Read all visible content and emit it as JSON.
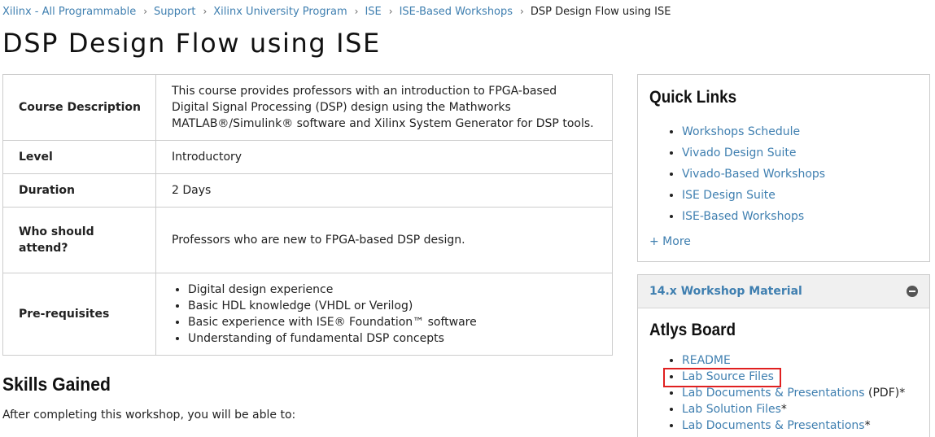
{
  "breadcrumb": {
    "items": [
      "Xilinx - All Programmable",
      "Support",
      "Xilinx University Program",
      "ISE",
      "ISE-Based Workshops"
    ],
    "current": "DSP Design Flow using ISE",
    "separator": "›"
  },
  "page_title": "DSP Design Flow using ISE",
  "course_table": {
    "description_label": "Course Description",
    "description_value": "This course provides professors with an introduction to FPGA-based Digital Signal Processing (DSP) design using the Mathworks MATLAB®/Simulink® software and Xilinx System Generator for DSP tools.",
    "level_label": "Level",
    "level_value": "Introductory",
    "duration_label": "Duration",
    "duration_value": "2 Days",
    "attend_label": "Who should attend?",
    "attend_value": "Professors who are new to FPGA-based DSP design.",
    "prereq_label": "Pre-requisites",
    "prereq_items": [
      "Digital design experience",
      "Basic HDL knowledge (VHDL or Verilog)",
      "Basic experience with ISE® Foundation™ software",
      "Understanding of fundamental DSP concepts"
    ]
  },
  "skills": {
    "heading": "Skills Gained",
    "intro": "After completing this workshop, you will be able to:"
  },
  "quick_links": {
    "title": "Quick Links",
    "items": [
      "Workshops Schedule",
      "Vivado Design Suite",
      "Vivado-Based Workshops",
      "ISE Design Suite",
      "ISE-Based Workshops"
    ],
    "more_label": "+ More"
  },
  "workshop_material": {
    "header": "14.x Workshop Material",
    "board_title": "Atlys Board",
    "items": [
      {
        "link": "README",
        "suffix": ""
      },
      {
        "link": "Lab Source Files",
        "suffix": ""
      },
      {
        "link": "Lab Documents & Presentations",
        "suffix": " (PDF)*"
      },
      {
        "link": "Lab Solution Files",
        "suffix": "*"
      },
      {
        "link": "Lab Documents & Presentations",
        "suffix": "*"
      }
    ],
    "highlighted_item": "Lab Source Files",
    "highlight_color": "#e02020"
  },
  "colors": {
    "link": "#3f7fb0",
    "border": "#cccccc",
    "panel_header_bg": "#f0f0f0"
  }
}
